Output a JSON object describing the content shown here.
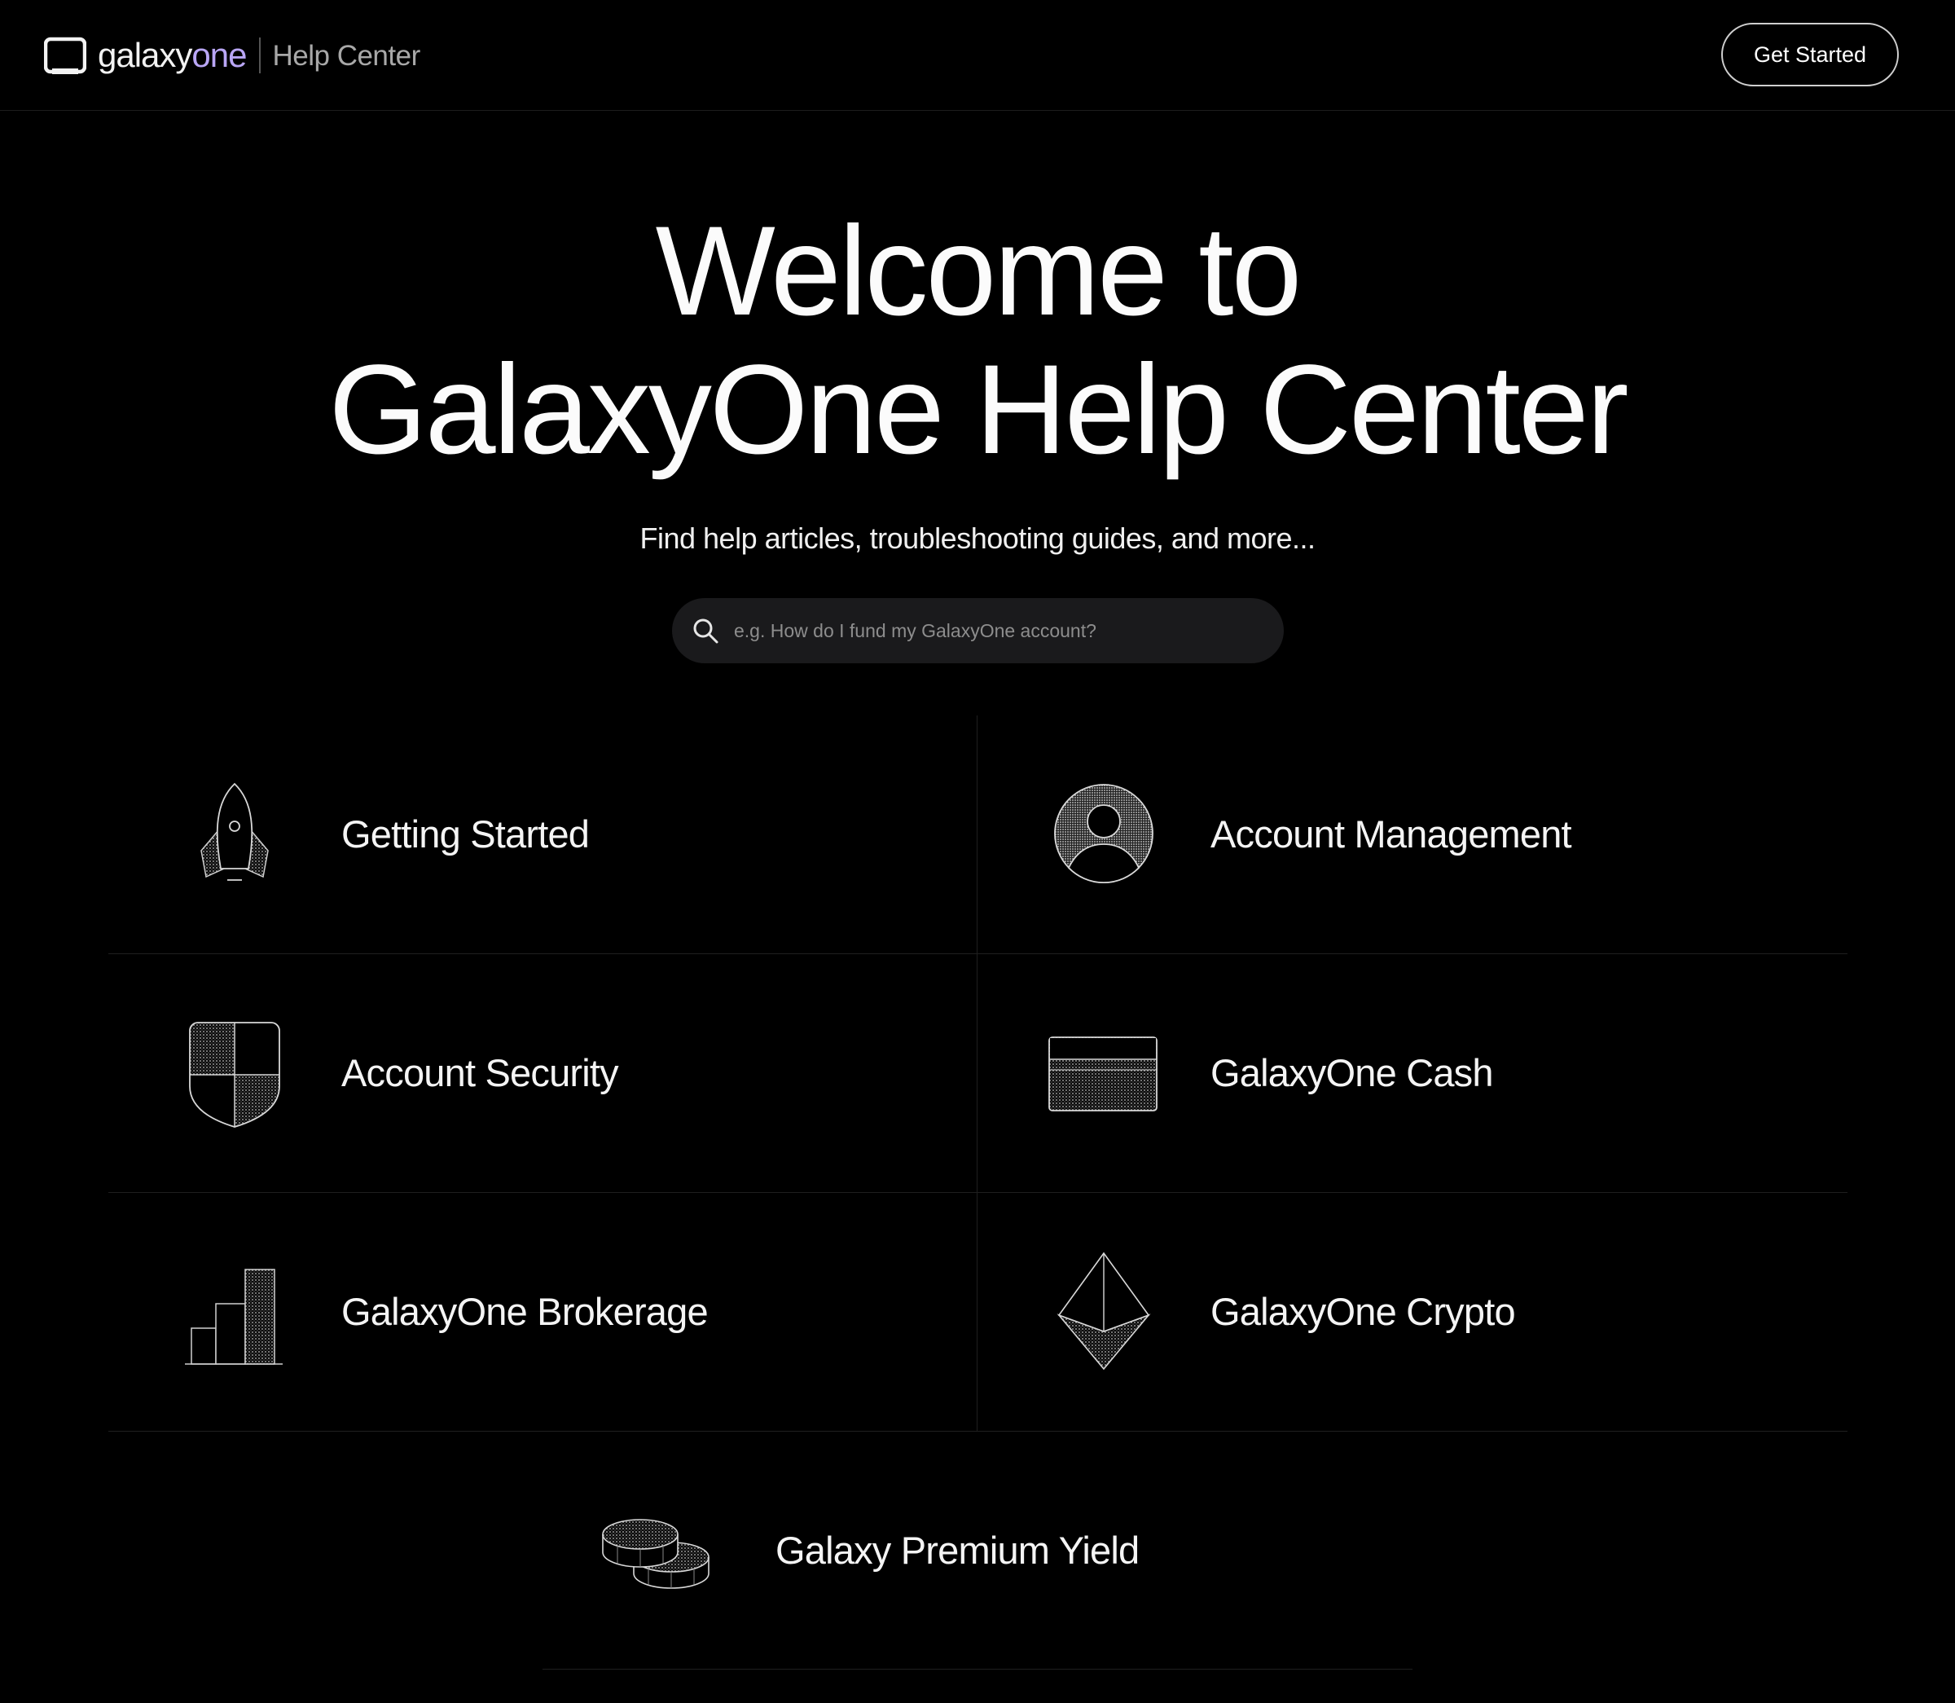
{
  "header": {
    "brand_word_main": "galaxy",
    "brand_word_accent": "one",
    "brand_sub": "Help Center",
    "cta_label": "Get Started"
  },
  "hero": {
    "title_line1": "Welcome to",
    "title_line2": "GalaxyOne Help Center",
    "subtitle": "Find help articles, troubleshooting guides, and more..."
  },
  "search": {
    "placeholder": "e.g. How do I fund my GalaxyOne account?",
    "value": ""
  },
  "categories": [
    {
      "label": "Getting Started",
      "icon": "rocket-icon"
    },
    {
      "label": "Account Management",
      "icon": "user-avatar-icon"
    },
    {
      "label": "Account Security",
      "icon": "shield-icon"
    },
    {
      "label": "GalaxyOne Cash",
      "icon": "card-icon"
    },
    {
      "label": "GalaxyOne Brokerage",
      "icon": "bar-chart-icon"
    },
    {
      "label": "GalaxyOne Crypto",
      "icon": "ethereum-icon"
    },
    {
      "label": "Galaxy Premium Yield",
      "icon": "coins-icon"
    }
  ],
  "colors": {
    "background": "#000000",
    "accent": "#b9a6f5",
    "search_bg": "#1a1a1c",
    "divider": "#1f1f1f"
  }
}
